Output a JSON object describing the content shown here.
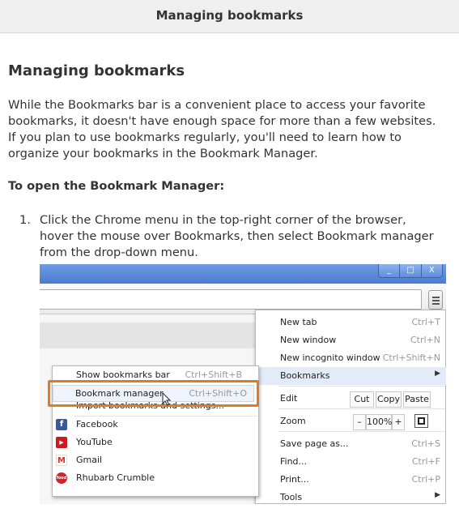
{
  "header": {
    "title": "Managing bookmarks"
  },
  "article": {
    "heading": "Managing bookmarks",
    "intro_lines": [
      "While the Bookmarks bar is a convenient place to access your favorite",
      "bookmarks, it doesn't have enough space for more than a few websites.",
      "If you plan to use bookmarks regularly, you'll need to learn how to",
      "organize your bookmarks in the Bookmark Manager."
    ],
    "subheading": "To open the Bookmark Manager:",
    "step_number": "1.",
    "step_lines": [
      "Click the Chrome menu in the top-right corner of the browser,",
      "hover the mouse over Bookmarks, then select Bookmark manager",
      "from the drop-down menu."
    ]
  },
  "screenshot": {
    "window_buttons": [
      "_",
      "□",
      "X"
    ],
    "chrome_menu": {
      "items": [
        {
          "label": "New tab",
          "shortcut": "Ctrl+T"
        },
        {
          "label": "New window",
          "shortcut": "Ctrl+N"
        },
        {
          "label": "New incognito window",
          "shortcut": "Ctrl+Shift+N"
        },
        {
          "label": "Bookmarks",
          "shortcut": "",
          "arrow": "▶"
        },
        {
          "label": "Edit",
          "buttons": [
            "Cut",
            "Copy",
            "Paste"
          ]
        },
        {
          "label": "Zoom",
          "zoom_minus": "–",
          "zoom_value": "100%",
          "zoom_plus": "+"
        },
        {
          "label": "Save page as...",
          "shortcut": "Ctrl+S"
        },
        {
          "label": "Find...",
          "shortcut": "Ctrl+F"
        },
        {
          "label": "Print...",
          "shortcut": "Ctrl+P"
        },
        {
          "label": "Tools",
          "shortcut": "",
          "arrow": "▶"
        }
      ]
    },
    "bookmarks_menu": {
      "show_bar": {
        "label": "Show bookmarks bar",
        "shortcut": "Ctrl+Shift+B"
      },
      "manager": {
        "label": "Bookmark manager",
        "shortcut": "Ctrl+Shift+O"
      },
      "import": {
        "label": "Import bookmarks and settings..."
      },
      "bookmarks": [
        {
          "label": "Facebook",
          "icon": "facebook-icon",
          "glyph": "f",
          "color": "#3b5998"
        },
        {
          "label": "YouTube",
          "icon": "youtube-icon",
          "glyph": "▶",
          "color": "#cc181e"
        },
        {
          "label": "Gmail",
          "icon": "gmail-icon",
          "glyph": "M",
          "color": "#ffffff"
        },
        {
          "label": "Rhubarb Crumble",
          "icon": "food-site-icon",
          "glyph": "food",
          "color": "#d0262d"
        }
      ]
    },
    "highlight_color": "#e07b23"
  }
}
